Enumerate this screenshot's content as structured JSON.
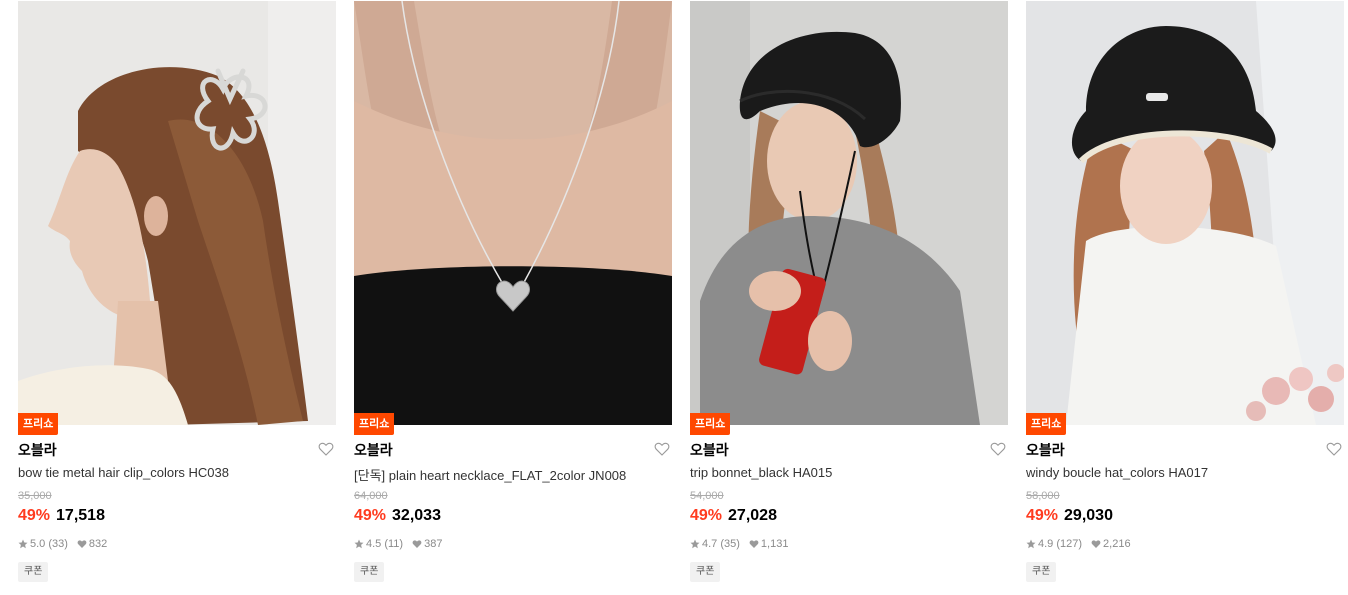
{
  "products": [
    {
      "badge": "프리쇼",
      "brand": "오블라",
      "name": "bow tie metal hair clip_colors HC038",
      "original_price": "35,000",
      "discount": "49%",
      "price": "17,518",
      "rating": "5.0 (33)",
      "likes": "832",
      "coupon": "쿠폰",
      "image_subject": "woman-with-metal-hair-clip"
    },
    {
      "badge": "프리쇼",
      "brand": "오블라",
      "name": "[단독] plain heart necklace_FLAT_2color JN008",
      "original_price": "64,000",
      "discount": "49%",
      "price": "32,033",
      "rating": "4.5 (11)",
      "likes": "387",
      "coupon": "쿠폰",
      "image_subject": "silver-heart-necklace"
    },
    {
      "badge": "프리쇼",
      "brand": "오블라",
      "name": "trip bonnet_black HA015",
      "original_price": "54,000",
      "discount": "49%",
      "price": "27,028",
      "rating": "4.7 (35)",
      "likes": "1,131",
      "coupon": "쿠폰",
      "image_subject": "woman-in-black-bonnet"
    },
    {
      "badge": "프리쇼",
      "brand": "오블라",
      "name": "windy boucle hat_colors HA017",
      "original_price": "58,000",
      "discount": "49%",
      "price": "29,030",
      "rating": "4.9 (127)",
      "likes": "2,216",
      "coupon": "쿠폰",
      "image_subject": "woman-in-boucle-bucket-hat"
    }
  ],
  "colors": {
    "badge_bg": "#ff4800",
    "discount": "#ff3b1f",
    "muted": "#8a8a8a"
  }
}
